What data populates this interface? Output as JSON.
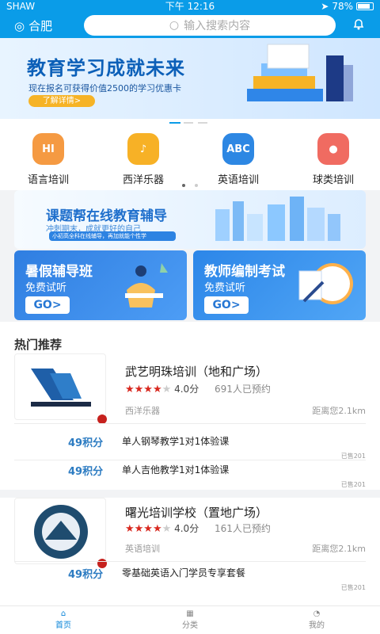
{
  "status": {
    "carrier": "SHAW",
    "time": "下午 12:16",
    "battery": "78%"
  },
  "header": {
    "city": "合肥",
    "search_placeholder": "输入搜索内容"
  },
  "banner": {
    "title": "教育学习成就未来",
    "subtitle": "现在报名可获得价值2500的学习优惠卡",
    "button": "了解详情>"
  },
  "categories": [
    {
      "label": "语言培训",
      "icon": "hi-icon",
      "color": "#f59a42"
    },
    {
      "label": "西洋乐器",
      "icon": "instrument-icon",
      "color": "#f7b126"
    },
    {
      "label": "英语培训",
      "icon": "abc-icon",
      "color": "#2d87e3"
    },
    {
      "label": "球类培训",
      "icon": "ball-icon",
      "color": "#f06b61"
    }
  ],
  "wide_card": {
    "title": "课题帮在线教育辅导",
    "subtitle": "冲刺期末，成就更好的自己",
    "note": "小初高全科在线辅导，再加就能个性学"
  },
  "promos": [
    {
      "title": "暑假辅导班",
      "subtitle": "免费试听",
      "button": "GO>",
      "color": "#2f7ee1"
    },
    {
      "title": "教师编制考试",
      "subtitle": "免费试听",
      "button": "GO>",
      "color": "#2c86e8"
    }
  ],
  "hot": {
    "title": "热门推荐",
    "stores": [
      {
        "name": "武艺明珠培训（地和广场）",
        "rating": 4.0,
        "rating_text": "4.0分",
        "bookings": "691人已预约",
        "category": "西洋乐器",
        "distance": "距离您2.1km"
      },
      {
        "name": "曙光培训学校（置地广场）",
        "rating": 4.0,
        "rating_text": "4.0分",
        "bookings": "161人已预约",
        "category": "英语培训",
        "distance": "距离您2.1km"
      }
    ],
    "items": [
      {
        "points": "49积分",
        "name": "单人钢琴教学1对1体验课",
        "sold": "已售201"
      },
      {
        "points": "49积分",
        "name": "单人吉他教学1对1体验课",
        "sold": "已售201"
      },
      {
        "points": "49积分",
        "name": "零基础英语入门学员专享套餐",
        "sold": "已售201"
      }
    ]
  },
  "nav": [
    {
      "label": "首页",
      "icon": "home-icon"
    },
    {
      "label": "分类",
      "icon": "grid-icon"
    },
    {
      "label": "我的",
      "icon": "user-icon"
    }
  ]
}
